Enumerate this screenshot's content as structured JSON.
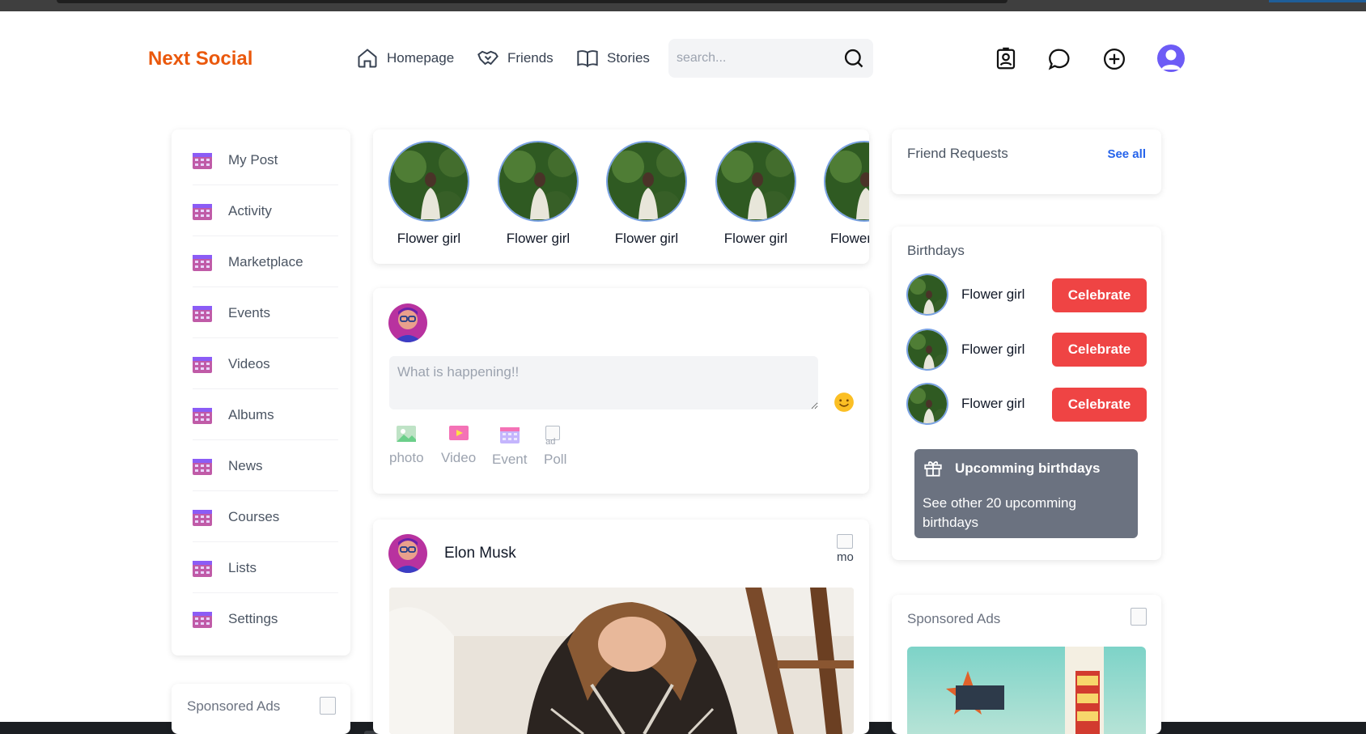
{
  "app": {
    "name": "Next Social"
  },
  "nav": {
    "homepage": "Homepage",
    "friends": "Friends",
    "stories": "Stories"
  },
  "search": {
    "placeholder": "search..."
  },
  "sidebar": {
    "items": [
      {
        "label": "My Post"
      },
      {
        "label": "Activity"
      },
      {
        "label": "Marketplace"
      },
      {
        "label": "Events"
      },
      {
        "label": "Videos"
      },
      {
        "label": "Albums"
      },
      {
        "label": "News"
      },
      {
        "label": "Courses"
      },
      {
        "label": "Lists"
      },
      {
        "label": "Settings"
      }
    ],
    "sponsored_label": "Sponsored Ads"
  },
  "stories": [
    {
      "name": "Flower girl"
    },
    {
      "name": "Flower girl"
    },
    {
      "name": "Flower girl"
    },
    {
      "name": "Flower girl"
    },
    {
      "name": "Flower girl"
    }
  ],
  "composer": {
    "placeholder": "What is happening!!",
    "options": [
      {
        "label": "photo",
        "icon": "photo-icon"
      },
      {
        "label": "Video",
        "icon": "video-icon"
      },
      {
        "label": "Event",
        "icon": "calendar-icon"
      },
      {
        "label": "Poll",
        "icon": "poll-icon",
        "broken_alt": "ad"
      }
    ]
  },
  "post": {
    "author": "Elon Musk",
    "more_alt": "mo"
  },
  "friend_requests": {
    "title": "Friend Requests",
    "see_all": "See all"
  },
  "birthdays": {
    "title": "Birthdays",
    "items": [
      {
        "name": "Flower girl",
        "button": "Celebrate"
      },
      {
        "name": "Flower girl",
        "button": "Celebrate"
      },
      {
        "name": "Flower girl",
        "button": "Celebrate"
      }
    ],
    "upcoming_title": "Upcomming birthdays",
    "upcoming_desc": "See other 20 upcomming birthdays"
  },
  "right_sponsored": {
    "label": "Sponsored Ads"
  },
  "colors": {
    "brand": "#ea580c",
    "celebrate": "#ef4444",
    "link": "#2563eb",
    "upcoming_bg": "#6b7280"
  }
}
